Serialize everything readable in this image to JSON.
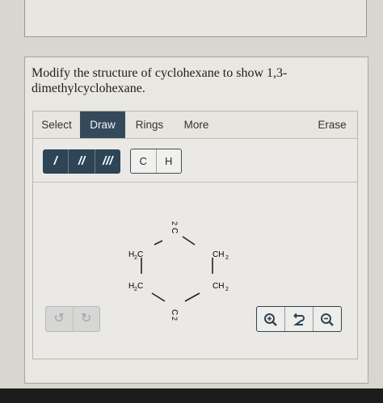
{
  "question": {
    "prompt": "Modify the structure of cyclohexane to show 1,3-dimethylcyclohexane."
  },
  "toolbar": {
    "tabs": [
      {
        "label": "Select",
        "active": false
      },
      {
        "label": "Draw",
        "active": true
      },
      {
        "label": "Rings",
        "active": false
      },
      {
        "label": "More",
        "active": false
      }
    ],
    "erase_label": "Erase"
  },
  "tools": {
    "bonds": [
      "/",
      "//",
      "///"
    ],
    "atoms": [
      "C",
      "H"
    ]
  },
  "molecule": {
    "top": {
      "sub": "2",
      "main": "C"
    },
    "upper_left": {
      "main": "H",
      "sub": "2",
      "tail": "C"
    },
    "upper_right": {
      "main": "CH",
      "sub": "2"
    },
    "lower_left": {
      "main": "H",
      "sub": "2",
      "tail": "C"
    },
    "lower_right": {
      "main": "CH",
      "sub": "2"
    },
    "bottom": {
      "main": "C",
      "sub": "2"
    }
  },
  "controls": {
    "undo_icon": "undo-icon",
    "redo_icon": "redo-icon",
    "zoom_in_icon": "zoom-in-icon",
    "reset_icon": "reset-zoom-icon",
    "zoom_out_icon": "zoom-out-icon"
  },
  "colors": {
    "accent": "#344a5c",
    "background": "#e9e7e2"
  }
}
